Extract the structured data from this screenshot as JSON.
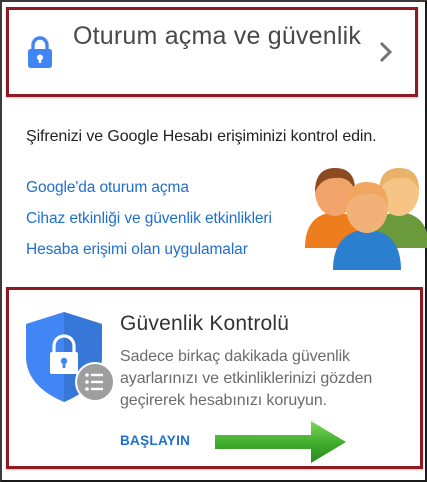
{
  "header": {
    "title": "Oturum açma ve güvenlik",
    "icon": "lock-icon",
    "chevron_icon": "chevron-right-icon",
    "accent_color": "#4285f4"
  },
  "description": "Şifrenizi ve Google Hesabı erişiminizi kontrol edin.",
  "links": [
    {
      "label": "Google'da oturum açma"
    },
    {
      "label": "Cihaz etkinliği ve güvenlik etkinlikleri"
    },
    {
      "label": "Hesaba erişimi olan uygulamalar"
    }
  ],
  "security_checkup": {
    "title": "Güvenlik Kontrolü",
    "description": "Sadece birkaç dakikada güvenlik ayarlarınızı ve etkinliklerinizi gözden geçirerek hesabınızı koruyun.",
    "button_label": "BAŞLAYIN",
    "icon": "shield-lock-icon",
    "badge_icon": "list-icon"
  },
  "colors": {
    "link": "#1f6fd0",
    "highlight_border": "#8e1b22",
    "arrow": "#3cab2a"
  }
}
